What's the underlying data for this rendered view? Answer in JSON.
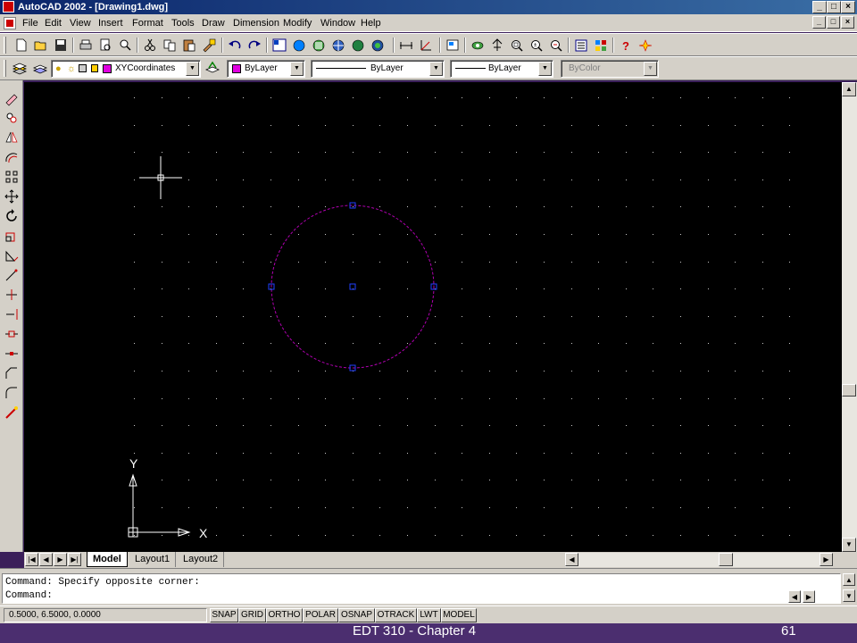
{
  "window": {
    "title": "AutoCAD 2002 - [Drawing1.dwg]",
    "controls": [
      "_",
      "□",
      "×"
    ],
    "mdi_controls": [
      "_",
      "□",
      "×"
    ]
  },
  "menu": {
    "items": [
      "File",
      "Edit",
      "View",
      "Insert",
      "Format",
      "Tools",
      "Draw",
      "Dimension",
      "Modify",
      "Window",
      "Help"
    ]
  },
  "toolbar_standard": {
    "icons": [
      "new-icon",
      "open-icon",
      "save-icon",
      "print-icon",
      "print-preview-icon",
      "find-icon",
      "cut-icon",
      "copy-icon",
      "paste-icon",
      "match-properties-icon",
      "undo-icon",
      "redo-icon",
      "design-center-icon",
      "today-icon",
      "publish-icon",
      "web-icon",
      "hyperlink-icon",
      "internet-icon",
      "distance-icon",
      "ucs-icon",
      "named-views-icon",
      "3d-orbit-icon",
      "pan-icon",
      "zoom-window-icon",
      "zoom-realtime-icon",
      "zoom-previous-icon",
      "properties-icon",
      "tool-palette-icon",
      "help-icon",
      "snap-marker-icon"
    ]
  },
  "toolbar_properties": {
    "layer_value": "XYCoordinates",
    "color_value": "ByLayer",
    "linetype_value": "ByLayer",
    "lineweight_value": "ByLayer",
    "plotstyle_value": "ByColor",
    "layer_color": "#e000e0",
    "swatch_color": "#e000e0"
  },
  "left_toolbar": {
    "icons": [
      "erase-icon",
      "copy-object-icon",
      "mirror-icon",
      "offset-icon",
      "array-icon",
      "move-icon",
      "rotate-icon",
      "scale-icon",
      "stretch-icon",
      "lengthen-icon",
      "trim-icon",
      "extend-icon",
      "break-icon",
      "break-at-point-icon",
      "chamfer-icon",
      "fillet-icon",
      "explode-icon"
    ]
  },
  "drawing": {
    "circle_color": "#b000b0",
    "grip_color": "#2040ff",
    "ucs_x_label": "X",
    "ucs_y_label": "Y"
  },
  "tabs": [
    "Model",
    "Layout1",
    "Layout2"
  ],
  "command": {
    "line1": "Command: Specify opposite corner:",
    "line2": "Command:"
  },
  "status": {
    "coordinates": "0.5000, 6.5000, 0.0000",
    "buttons": [
      "SNAP",
      "GRID",
      "ORTHO",
      "POLAR",
      "OSNAP",
      "OTRACK",
      "LWT",
      "MODEL"
    ]
  },
  "footer": {
    "text": "EDT 310 - Chapter 4",
    "page": "61"
  }
}
